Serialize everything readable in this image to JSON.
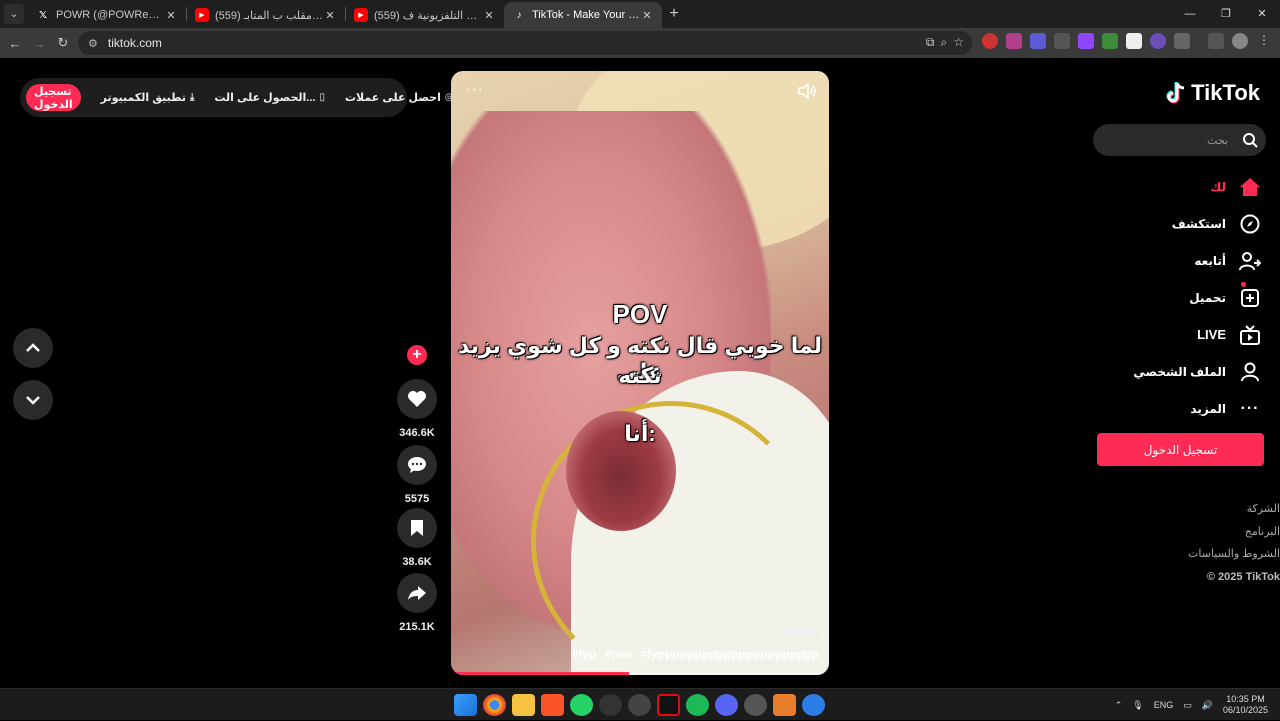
{
  "browser": {
    "tabs": [
      {
        "title": "POWR (@POWReSports) / X",
        "favicon": "x-logo",
        "active": false
      },
      {
        "title": "(559) كيف تسوي مقلب ب المتابـ",
        "favicon": "youtube",
        "active": false
      },
      {
        "title": "(559) مقلب المقابلة التلفزيونية ف",
        "favicon": "youtube",
        "active": false
      },
      {
        "title": "TikTok - Make Your Day",
        "favicon": "tiktok",
        "active": true
      }
    ],
    "url": "tiktok.com",
    "window_controls": {
      "minimize": "—",
      "maximize": "❐",
      "close": "✕"
    }
  },
  "topbar": {
    "login": "تسجيل الدخول",
    "desktop_app": "تطبيق الكمبيوتر",
    "get_app": "الحصول على الت...",
    "coins": "احصل على عملات"
  },
  "sidebar": {
    "logo": "TikTok",
    "search_placeholder": "بحث",
    "nav": [
      {
        "label": "لك",
        "icon": "home-icon",
        "active": true
      },
      {
        "label": "استكشف",
        "icon": "compass-icon"
      },
      {
        "label": "أتابعه",
        "icon": "following-icon"
      },
      {
        "label": "تحميل",
        "icon": "upload-icon"
      },
      {
        "label": "LIVE",
        "icon": "live-icon"
      },
      {
        "label": "الملف الشخصي",
        "icon": "profile-icon"
      },
      {
        "label": "المزيد",
        "icon": "more-icon"
      }
    ],
    "login": "تسجيل الدخول",
    "footer": [
      "الشركة",
      "البرنامج",
      "الشروط والسياسات"
    ],
    "copyright": "© 2025 TikTok"
  },
  "video": {
    "caption_pov": "POV",
    "caption_line1": "لما خويي قال نكته و كل شوي يزيد على",
    "caption_line2": "نكته",
    "caption_me": "أنا:",
    "author": "kiki10.0",
    "tags": [
      "#fyp",
      "#pov",
      "#fypppppppppppppppppppppp"
    ],
    "progress": 0.47
  },
  "actions": {
    "likes": "346.6K",
    "comments": "5575",
    "saves": "38.6K",
    "shares": "215.1K"
  },
  "taskbar": {
    "lang": "ENG",
    "time": "10:35 PM",
    "date": "06/10/2025"
  },
  "colors": {
    "accent": "#fe2c55",
    "background": "#000000",
    "panel": "#2a2a2a"
  }
}
